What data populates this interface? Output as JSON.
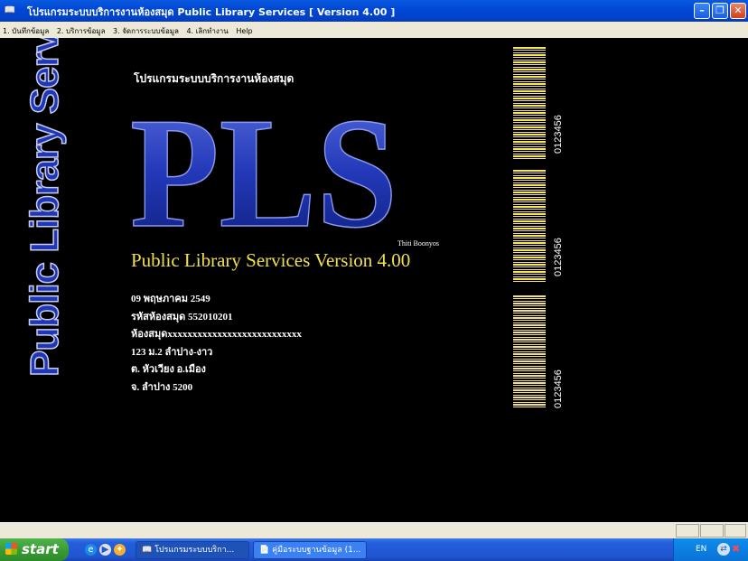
{
  "window": {
    "app_icon": "library-book-icon",
    "title": "โปรแกรมระบบบริการงานห้องสมุด  Public Library Services  [ Version 4.00 ]"
  },
  "menu": {
    "items": [
      {
        "label": "1. บันทึกข้อมูล"
      },
      {
        "label": "2. บริการข้อมูล"
      },
      {
        "label": "3. จัดการระบบข้อมูล"
      },
      {
        "label": "4. เลิกทำงาน"
      },
      {
        "label": "Help"
      }
    ]
  },
  "splash": {
    "vertical_title": "Public Library Services",
    "thai_subtitle": "โปรแกรมระบบบริการงานห้องสมุด",
    "logo_text": "PLS",
    "author": "Thiti   Boonyos",
    "version_line": "Public Library Services  Version 4.00",
    "info_lines": [
      "09  พฤษภาคม  2549",
      "รหัสห้องสมุด  552010201",
      "ห้องสมุดxxxxxxxxxxxxxxxxxxxxxxxxxxx",
      "123 ม.2 ลำปาง-งาว",
      "ต. หัวเวียง    อ.เมือง",
      "จ. ลำปาง   5200"
    ],
    "barcodes": [
      {
        "number": "0123456"
      },
      {
        "number": "0123456"
      },
      {
        "number": "0123456"
      }
    ],
    "colors": {
      "accent_yellow": "#f2e14a",
      "logo_blue": "#1e36b8"
    }
  },
  "taskbar": {
    "start_label": "start",
    "quick_launch": [
      {
        "icon": "internet-explorer-icon"
      },
      {
        "icon": "media-player-icon"
      },
      {
        "icon": "messenger-icon"
      }
    ],
    "tasks": [
      {
        "label": "โปรแกรมระบบบริกา...",
        "icon": "library-book-icon"
      },
      {
        "label": "คู่มือระบบฐานข้อมูล (1...",
        "icon": "word-document-icon"
      }
    ],
    "tray": {
      "language": "EN"
    }
  }
}
